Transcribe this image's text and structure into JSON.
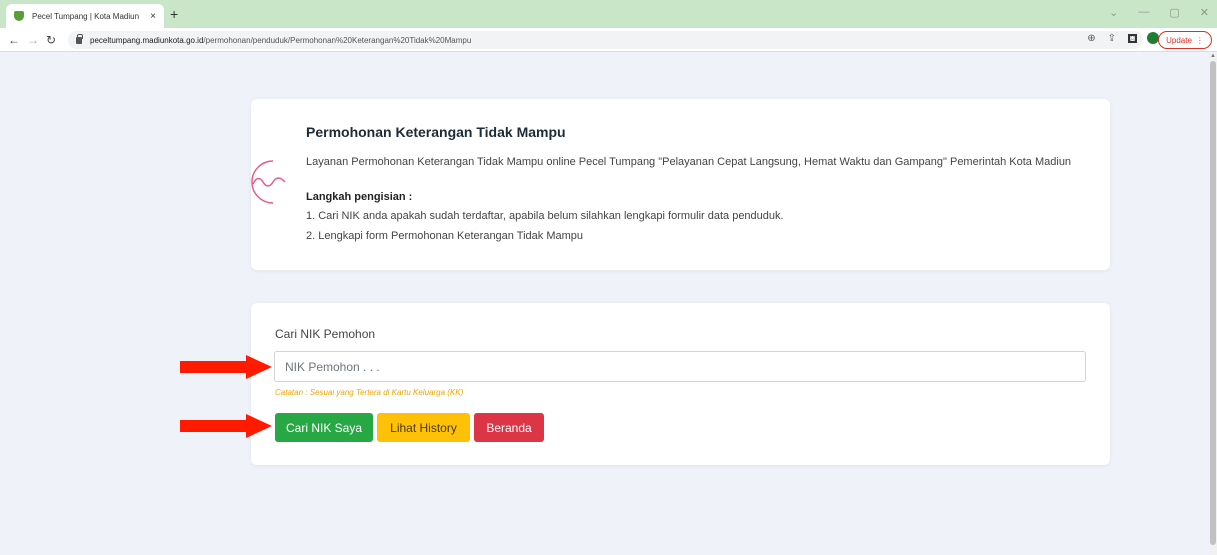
{
  "browser": {
    "tab_title": "Pecel Tumpang | Kota Madiun",
    "tab_close": "×",
    "new_tab": "+",
    "url_host": "peceltumpang.madiunkota.go.id",
    "url_path": "/permohonan/penduduk/Permohonan%20Keterangan%20Tidak%20Mampu",
    "update_label": "Update",
    "update_menu": "⋮",
    "win_min": "—",
    "win_restore": "▢",
    "win_close": "✕",
    "win_chevron": "⌄"
  },
  "info": {
    "title": "Permohonan Keterangan Tidak Mampu",
    "description": "Layanan Permohonan Keterangan Tidak Mampu online Pecel Tumpang \"Pelayanan Cepat Langsung, Hemat Waktu dan Gampang\" Pemerintah Kota Madiun",
    "steps_title": "Langkah pengisian :",
    "steps": [
      "1. Cari NIK anda apakah sudah terdaftar, apabila belum silahkan lengkapi formulir data penduduk.",
      "2. Lengkapi form Permohonan Keterangan Tidak Mampu"
    ]
  },
  "search": {
    "label": "Cari NIK Pemohon",
    "placeholder": "NIK Pemohon . . .",
    "value": "",
    "note": "Catatan : Sesuai yang Tertera di Kartu Keluarga (KK)",
    "btn_search": "Cari NIK Saya",
    "btn_history": "Lihat History",
    "btn_home": "Beranda"
  },
  "colors": {
    "green": "#28a745",
    "yellow": "#ffc107",
    "red": "#dc3545",
    "arrow": "#ff1a00",
    "deco": "#e85a8a"
  }
}
